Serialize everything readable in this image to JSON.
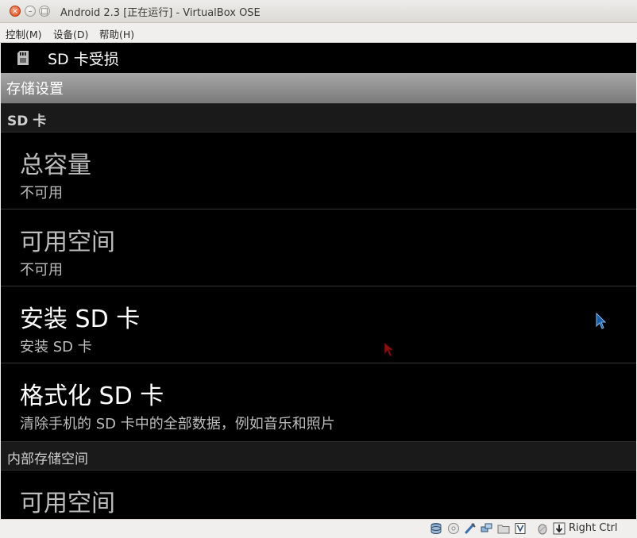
{
  "window": {
    "title": "Android 2.3 [正在运行] - VirtualBox OSE",
    "close_glyph": "×",
    "min_glyph": "–",
    "max_glyph": "□"
  },
  "menubar": {
    "items": [
      {
        "label": "控制(M)"
      },
      {
        "label": "设备(D)"
      },
      {
        "label": "帮助(H)"
      }
    ]
  },
  "android": {
    "title": "SD 卡受损",
    "header": "存储设置",
    "sd_category": "SD 卡",
    "internal_category": "内部存储空间",
    "prefs": [
      {
        "title": "总容量",
        "summary": "不可用",
        "enabled": false
      },
      {
        "title": "可用空间",
        "summary": "不可用",
        "enabled": false
      },
      {
        "title": "安装 SD 卡",
        "summary": "安装 SD 卡",
        "enabled": true
      },
      {
        "title": "格式化 SD 卡",
        "summary": "清除手机的 SD 卡中的全部数据，例如音乐和照片",
        "enabled": true
      },
      {
        "title": "可用空间",
        "summary": "",
        "enabled": false
      }
    ]
  },
  "statusbar": {
    "host_key": "Right Ctrl",
    "icons": [
      "hard-disk-icon",
      "cd-icon",
      "usb-icon",
      "network-icon",
      "shared-folder-icon",
      "vrdp-icon",
      "mouse-integration-icon",
      "host-key-arrow-icon"
    ]
  },
  "colors": {
    "android_bg": "#000000",
    "header_gradient_top": "#a7a7a7",
    "header_gradient_bottom": "#7a7a7a",
    "close_button": "#df4a16"
  }
}
